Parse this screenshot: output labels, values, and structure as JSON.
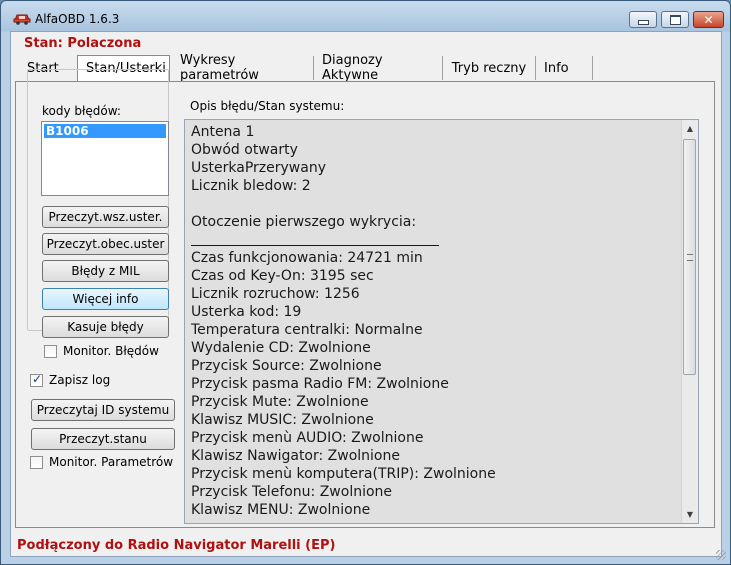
{
  "window": {
    "title": "AlfaOBD 1.6.3"
  },
  "status_top": "Stan: Polaczona",
  "tabs": [
    {
      "label": "Start"
    },
    {
      "label": "Stan/Usterki"
    },
    {
      "label": "Wykresy parametrów"
    },
    {
      "label": "Diagnozy Aktywne"
    },
    {
      "label": "Tryb reczny"
    },
    {
      "label": "Info"
    }
  ],
  "active_tab": "Stan/Usterki",
  "left_panel": {
    "codes_label": "kody błędów:",
    "codes": [
      "B1006"
    ],
    "selected_code": "B1006",
    "buttons": {
      "read_all": "Przeczyt.wsz.uster.",
      "read_current": "Przeczyt.obec.uster",
      "mil_errors": "Błędy z MIL",
      "more_info": "Więcej info",
      "clear_errors": "Kasuje błędy"
    },
    "monitor_errors": {
      "label": "Monitor. Błędów",
      "checked": false
    },
    "save_log": {
      "label": "Zapisz log",
      "checked": true
    },
    "read_id_button": "Przeczytaj ID systemu",
    "read_state_button": "Przeczyt.stanu",
    "monitor_params": {
      "label": "Monitor. Parametrów",
      "checked": false
    }
  },
  "description": {
    "label": "Opis błędu/Stan systemu:",
    "lines": [
      "Antena 1",
      "Obwód otwarty",
      "UsterkaPrzerywany",
      "Licznik bledow: 2",
      "",
      "Otoczenie pierwszego wykrycia:",
      "",
      "Czas funkcjonowania: 24721 min",
      "Czas od Key-On: 3195 sec",
      "Licznik rozruchow: 1256",
      "Usterka kod: 19",
      "Temperatura centralki: Normalne",
      "Wydalenie CD: Zwolnione",
      "Przycisk Source: Zwolnione",
      "Przycisk pasma Radio FM: Zwolnione",
      "Przycisk Mute: Zwolnione",
      "Klawisz MUSIC: Zwolnione",
      "Przycisk menù AUDIO: Zwolnione",
      "Klawisz Nawigator: Zwolnione",
      "Przycisk menù komputera(TRIP): Zwolnione",
      "Przycisk Telefonu: Zwolnione",
      "Klawisz MENU: Zwolnione"
    ]
  },
  "status_bottom": "Podłączony do Radio Navigator Marelli (EP)",
  "colors": {
    "status_red": "#b01010",
    "selection_blue": "#3399ff"
  }
}
